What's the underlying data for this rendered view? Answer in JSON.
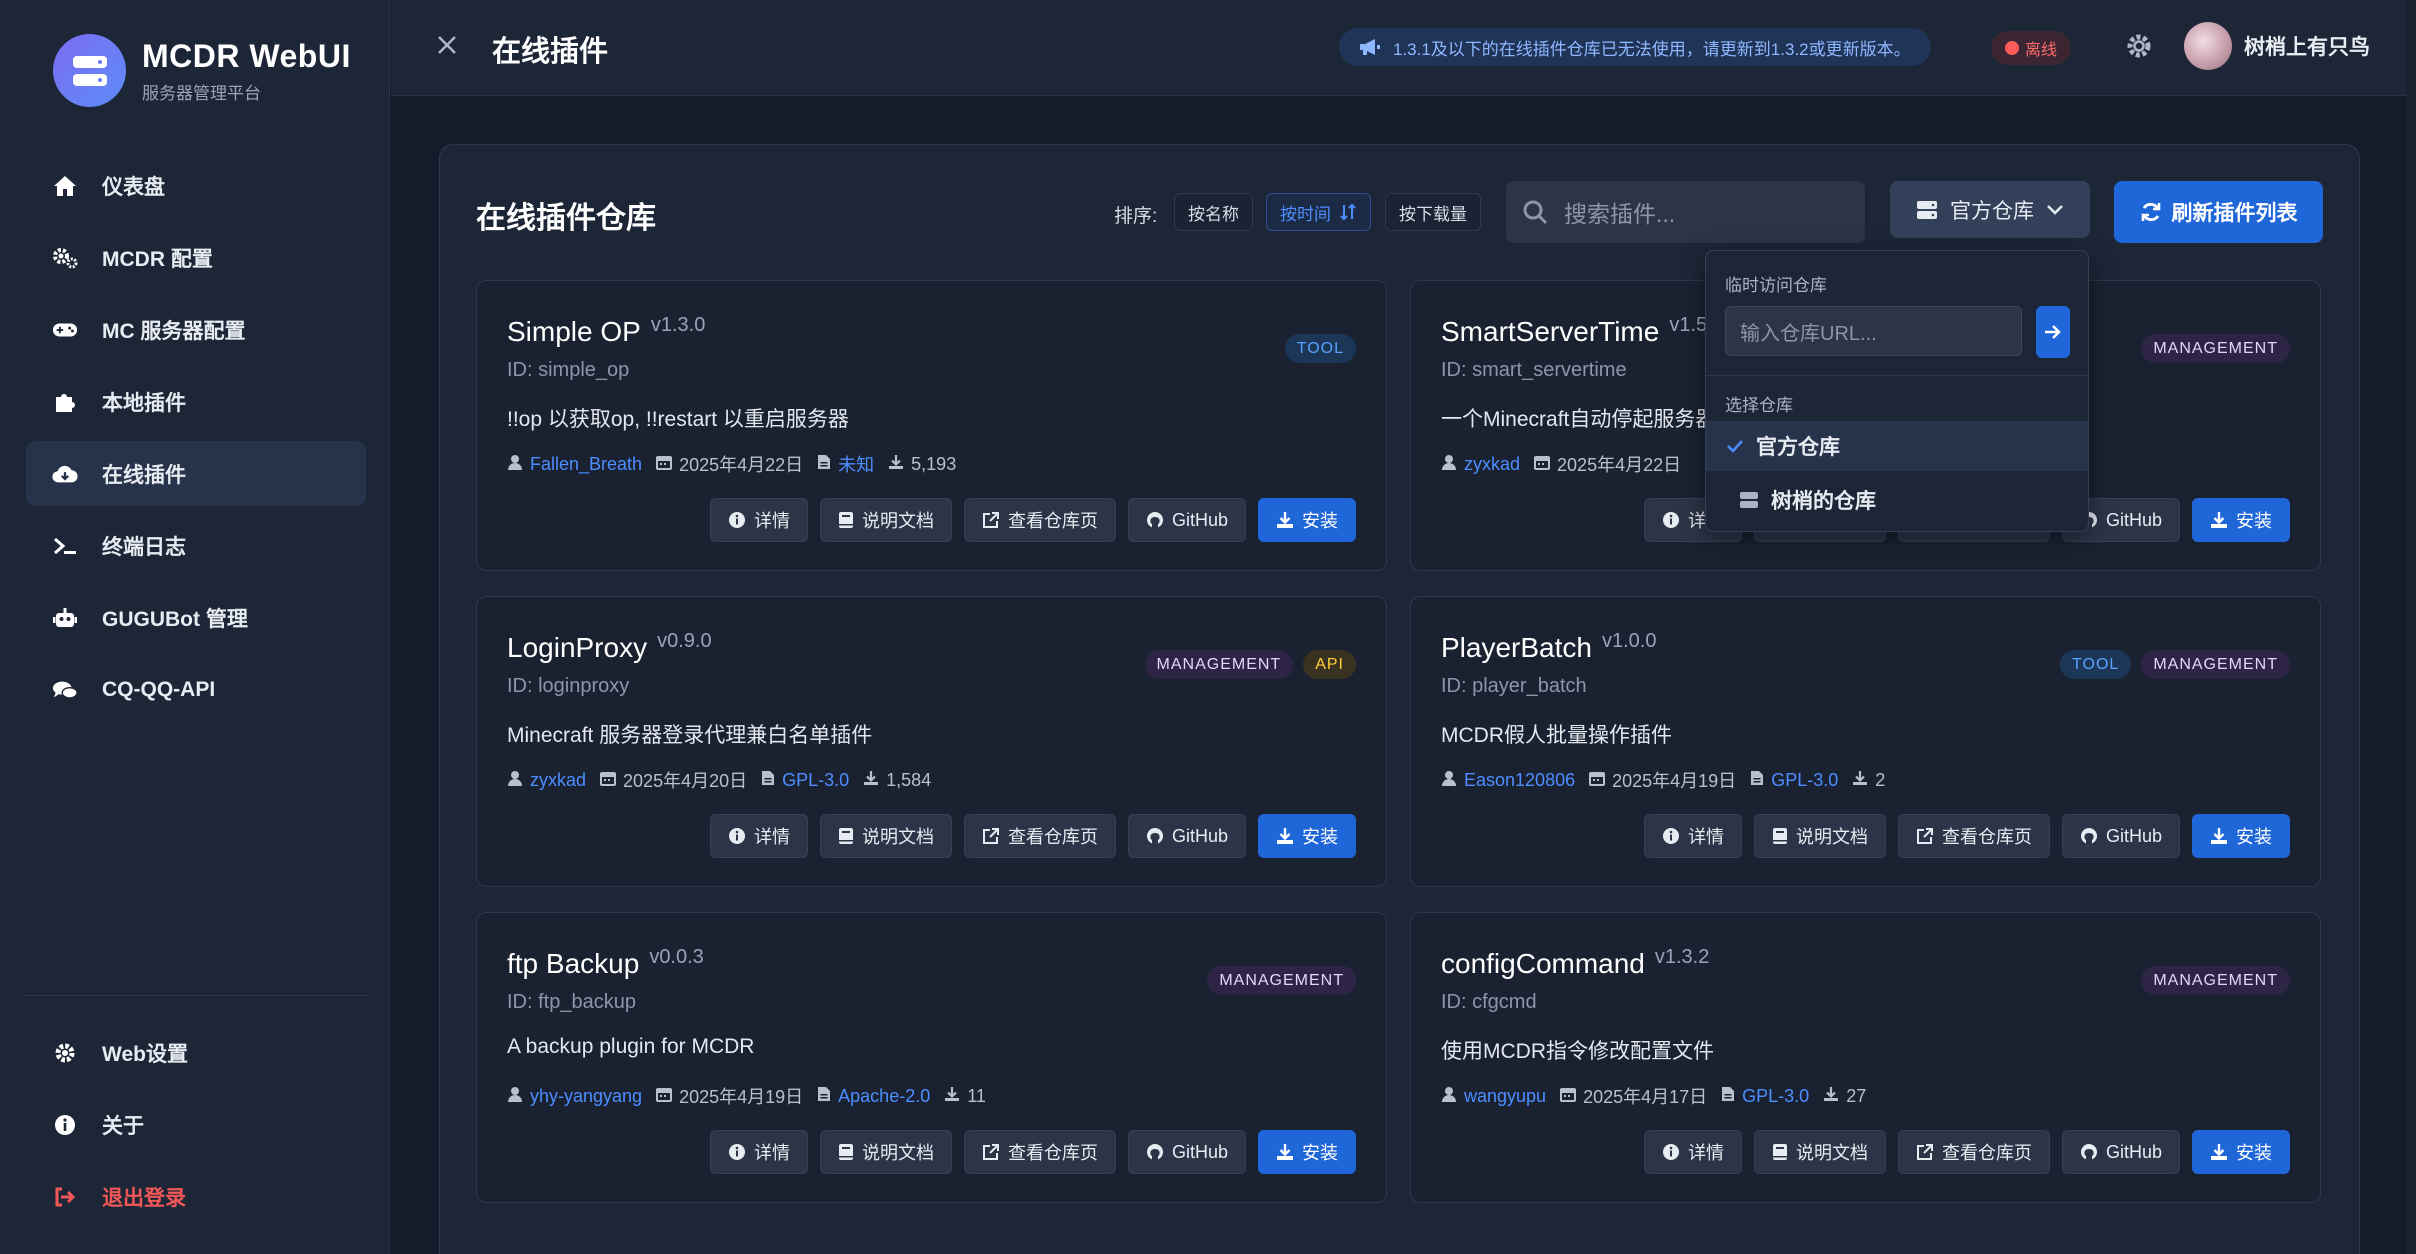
{
  "brand": {
    "title": "MCDR WebUI",
    "subtitle": "服务器管理平台"
  },
  "nav": {
    "items": [
      {
        "label": "仪表盘",
        "icon": "home-icon"
      },
      {
        "label": "MCDR 配置",
        "icon": "cogs-icon"
      },
      {
        "label": "MC 服务器配置",
        "icon": "gamepad-icon"
      },
      {
        "label": "本地插件",
        "icon": "puzzle-icon"
      },
      {
        "label": "在线插件",
        "icon": "cloud-download-icon"
      },
      {
        "label": "终端日志",
        "icon": "terminal-icon"
      },
      {
        "label": "GUGUBot 管理",
        "icon": "robot-icon"
      },
      {
        "label": "CQ-QQ-API",
        "icon": "comments-icon"
      }
    ],
    "bottom": [
      {
        "label": "Web设置",
        "icon": "gear-icon"
      },
      {
        "label": "关于",
        "icon": "info-icon"
      },
      {
        "label": "退出登录",
        "icon": "logout-icon"
      }
    ]
  },
  "header": {
    "title": "在线插件",
    "notice": "1.3.1及以下的在线插件仓库已无法使用，请更新到1.3.2或更新版本。",
    "status": "离线",
    "username": "树梢上有只鸟"
  },
  "panel": {
    "title": "在线插件仓库",
    "sort_label": "排序:",
    "sort_options": [
      "按名称",
      "按时间",
      "按下载量"
    ],
    "search_placeholder": "搜索插件...",
    "repo_label": "官方仓库",
    "refresh_label": "刷新插件列表"
  },
  "dropdown": {
    "temp_header": "临时访问仓库",
    "url_placeholder": "输入仓库URL...",
    "select_header": "选择仓库",
    "options": [
      "官方仓库",
      "树梢的仓库"
    ]
  },
  "actions": {
    "details": "详情",
    "docs": "说明文档",
    "repo": "查看仓库页",
    "github": "GitHub",
    "install": "安装"
  },
  "plugins": [
    {
      "name": "Simple OP",
      "version": "v1.3.0",
      "id": "ID: simple_op",
      "desc": "!!op 以获取op, !!restart 以重启服务器",
      "author": "Fallen_Breath",
      "date": "2025年4月22日",
      "license": "未知",
      "downloads": "5,193",
      "tags": [
        "TOOL"
      ]
    },
    {
      "name": "SmartServerTime",
      "version": "v1.5",
      "id": "ID: smart_servertime",
      "desc": "一个Minecraft自动停起服务器",
      "author": "zyxkad",
      "date": "2025年4月22日",
      "license": "",
      "downloads": "",
      "tags": [
        "MANAGEMENT"
      ]
    },
    {
      "name": "LoginProxy",
      "version": "v0.9.0",
      "id": "ID: loginproxy",
      "desc": "Minecraft 服务器登录代理兼白名单插件",
      "author": "zyxkad",
      "date": "2025年4月20日",
      "license": "GPL-3.0",
      "downloads": "1,584",
      "tags": [
        "MANAGEMENT",
        "API"
      ]
    },
    {
      "name": "PlayerBatch",
      "version": "v1.0.0",
      "id": "ID: player_batch",
      "desc": "MCDR假人批量操作插件",
      "author": "Eason120806",
      "date": "2025年4月19日",
      "license": "GPL-3.0",
      "downloads": "2",
      "tags": [
        "TOOL",
        "MANAGEMENT"
      ]
    },
    {
      "name": "ftp Backup",
      "version": "v0.0.3",
      "id": "ID: ftp_backup",
      "desc": "A backup plugin for MCDR",
      "author": "yhy-yangyang",
      "date": "2025年4月19日",
      "license": "Apache-2.0",
      "downloads": "11",
      "tags": [
        "MANAGEMENT"
      ]
    },
    {
      "name": "configCommand",
      "version": "v1.3.2",
      "id": "ID: cfgcmd",
      "desc": "使用MCDR指令修改配置文件",
      "author": "wangyupu",
      "date": "2025年4月17日",
      "license": "GPL-3.0",
      "downloads": "27",
      "tags": [
        "MANAGEMENT"
      ]
    }
  ]
}
